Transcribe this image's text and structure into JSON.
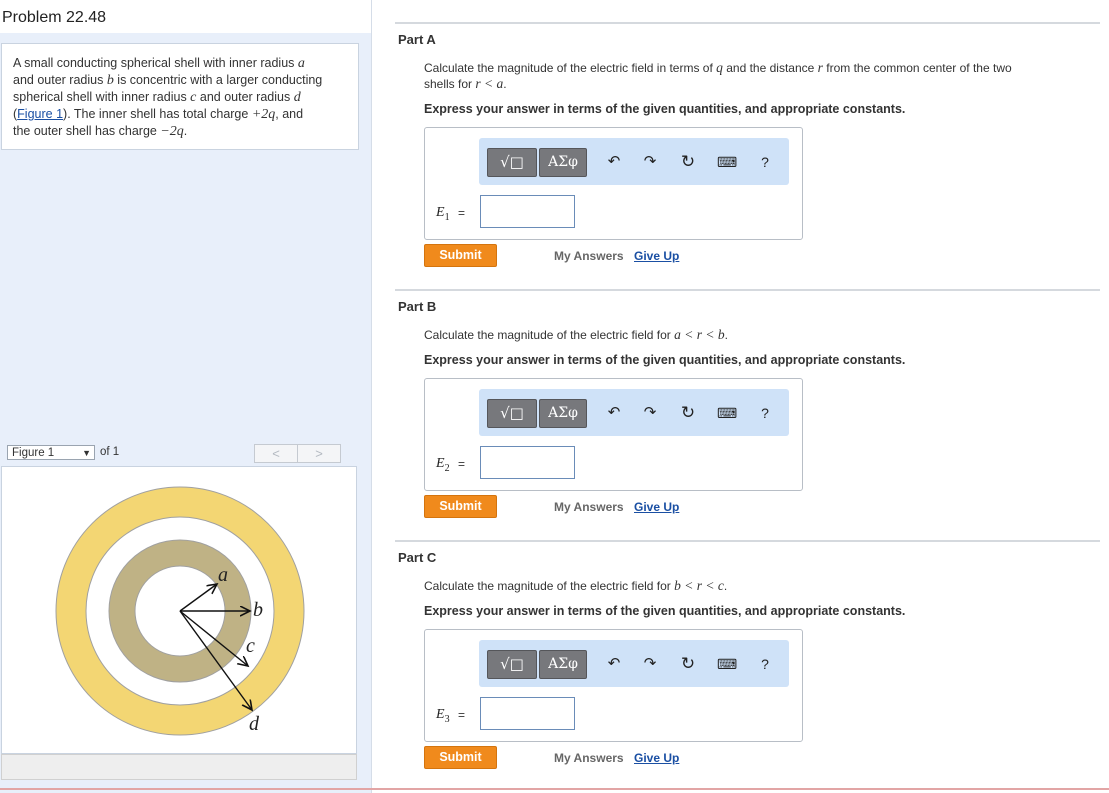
{
  "problem": {
    "title": "Problem 22.48",
    "statement": {
      "t1": "A small conducting spherical shell with inner radius ",
      "a": "a",
      "t2": "and outer radius ",
      "b": "b",
      "t3": " is concentric with a larger conducting",
      "t4": "spherical shell with inner radius ",
      "c": "c",
      "t5": " and outer radius ",
      "d": "d",
      "fig_link": "Figure 1",
      "t6": ". The inner shell has total charge ",
      "charge_inner": "+2q",
      "t7": ", and",
      "t8": "the outer shell has charge ",
      "charge_outer": "−2q",
      "t9": "."
    }
  },
  "figure_nav": {
    "selected": "Figure 1",
    "of_label": "of 1",
    "prev": "<",
    "next": ">",
    "labels": {
      "a": "a",
      "b": "b",
      "c": "c",
      "d": "d"
    },
    "colors": {
      "inner_shell": "#bfb285",
      "outer_shell": "#f3d673",
      "outline": "#a0a0a0"
    }
  },
  "toolbar": {
    "templates": "√□",
    "symbols": "ΑΣφ",
    "undo": "↶",
    "redo": "↷",
    "reset": "↻",
    "keyboard": "⌨",
    "help": "?"
  },
  "parts": [
    {
      "title": "Part A",
      "desc_1": "Calculate the magnitude of the electric field in terms of ",
      "q": "q",
      "desc_2": " and the distance ",
      "r": "r",
      "desc_3": " from the common center of the two",
      "desc_4": "shells for ",
      "cond": "r < a",
      "desc_5": ".",
      "express": "Express your answer in terms of the given quantities, and appropriate constants.",
      "label": "E",
      "sub": "1",
      "eq": "=",
      "value": "",
      "submit": "Submit",
      "my_answers": "My Answers",
      "give_up": "Give Up"
    },
    {
      "title": "Part B",
      "desc_1": "Calculate the magnitude of the electric field for ",
      "cond": "a < r < b",
      "desc_5": ".",
      "express": "Express your answer in terms of the given quantities, and appropriate constants.",
      "label": "E",
      "sub": "2",
      "eq": "=",
      "value": "",
      "submit": "Submit",
      "my_answers": "My Answers",
      "give_up": "Give Up"
    },
    {
      "title": "Part C",
      "desc_1": "Calculate the magnitude of the electric field for ",
      "cond": "b < r < c",
      "desc_5": ".",
      "express": "Express your answer in terms of the given quantities, and appropriate constants.",
      "label": "E",
      "sub": "3",
      "eq": "=",
      "value": "",
      "submit": "Submit",
      "my_answers": "My Answers",
      "give_up": "Give Up"
    }
  ]
}
